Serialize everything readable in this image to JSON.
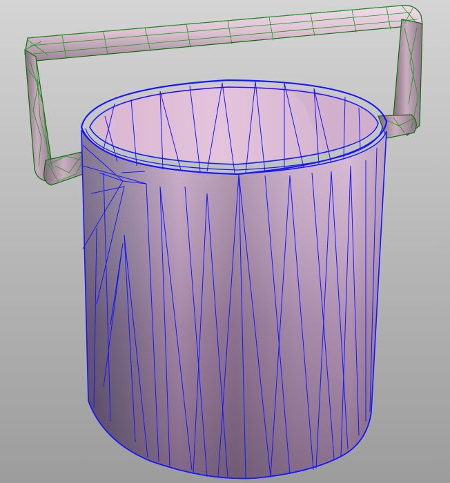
{
  "viewport": {
    "background_top": "#d4d4d4",
    "background_bottom": "#9c9c9c"
  },
  "handle": {
    "fill_light": "#e8cdde",
    "fill_mid": "#b89aac",
    "fill_dark": "#7e6878",
    "wire_color": "#1a9a1a",
    "wire_dark": "#0e6e0e"
  },
  "bucket": {
    "fill_highlight": "#e2bdd8",
    "fill_mid": "#a98ba8",
    "fill_shadow": "#6c5a72",
    "wire_color": "#1515ff"
  }
}
